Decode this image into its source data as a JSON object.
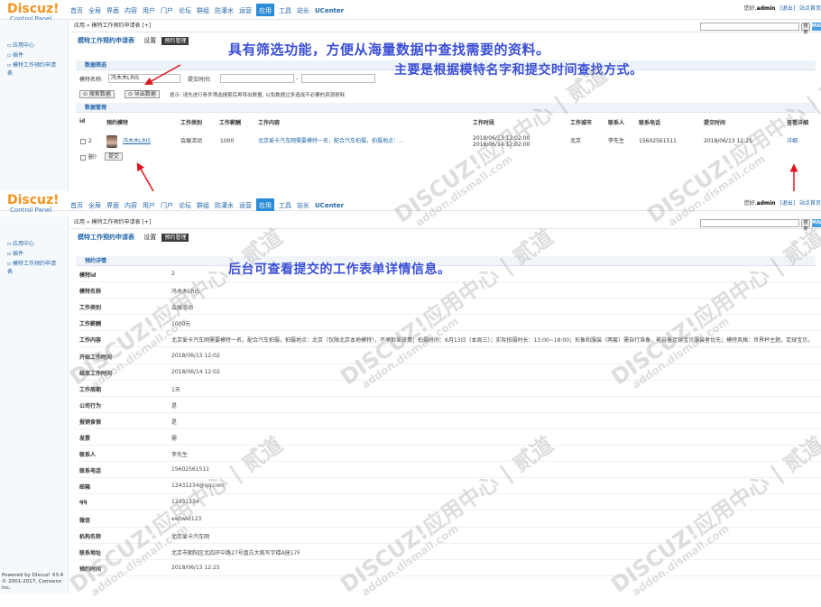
{
  "logo": {
    "name": "Discuz!",
    "sub": "Control Panel"
  },
  "nav": [
    "首页",
    "全局",
    "界面",
    "内容",
    "用户",
    "门户",
    "论坛",
    "群组",
    "防灌水",
    "运营",
    "应用",
    "工具",
    "站长",
    "UCenter"
  ],
  "nav_active_index": 10,
  "topbar": {
    "greeting": "您好,",
    "user": "admin",
    "logout": "[退出]",
    "home": "站点首页"
  },
  "search": {
    "button": "搜索",
    "map": "MAP"
  },
  "sidebar": {
    "items": [
      "应用中心",
      "插件",
      "模特工作预约申请表"
    ]
  },
  "powered": {
    "line1": "Powered by Discuz! X3.4",
    "line2": "© 2001-2017, Comsenz Inc."
  },
  "crumb": "应用 » 模特工作预约申请表 [+]",
  "tabs": {
    "title": "模特工作预约申请表",
    "settings": "设置",
    "manage": "预约管理"
  },
  "shot1": {
    "section_filter": "数据筛选",
    "filter": {
      "name_label": "模特名称:",
      "name_value": "冯木木LRIS",
      "time_label": "提交时间:",
      "dash": "-"
    },
    "buttons": {
      "search": "⊙ 搜索数据",
      "export": "⊙ 导出数据"
    },
    "tip": "提示: 请先进行条件筛选搜索后再导出数据, 以免数据过多造成不必要的资源损耗",
    "section_manage": "数据管理",
    "columns": [
      "id",
      "预约模特",
      "工作类别",
      "工作薪酬",
      "工作内容",
      "工作时段",
      "工作城市",
      "联系人",
      "联系电话",
      "提交时间",
      "查看详细"
    ],
    "row": {
      "id": "2",
      "model": "冯木木LRIS",
      "category": "会展活动",
      "pay": "1000",
      "content": "北京爱卡汽车网需要模特一名，配合汽车拍摄，拍摄地点：...",
      "period1": "2018/06/13 12:02:00",
      "period2": "2018/06/14 12:02:00",
      "city": "北京",
      "contact": "李先生",
      "phone": "15602561511",
      "submitted": "2018/06/13 12:25",
      "detail": "详细"
    },
    "delete_label": "删?",
    "submit": "提交",
    "callout1": "具有筛选功能，方便从海量数据中查找需要的资料。",
    "callout2": "主要是根据模特名字和提交时间查找方式。"
  },
  "shot2": {
    "section": "预约详情",
    "callout": "后台可查看提交的工作表单详情信息。",
    "fields": [
      {
        "k": "模特id",
        "v": "2"
      },
      {
        "k": "模特名称",
        "v": "冯木木LRIS"
      },
      {
        "k": "工作类别",
        "v": "会展活动"
      },
      {
        "k": "工作薪酬",
        "v": "1000元"
      },
      {
        "k": "工作内容",
        "v": "北京爱卡汽车网需要模特一名，配合汽车拍摄，拍摄地点：北京（仅限北京本地模特），不承担差旅费；拍摄时间：6月13日（本周三）；实际拍摄时长：13:00~18:00；形象和服装（两套）需自行准备，能自备足球宝贝服装者优先；模特风格：世界杯主题，足球宝贝。"
      },
      {
        "k": "开始工作时间",
        "v": "2018/06/13 12:02"
      },
      {
        "k": "结束工作时间",
        "v": "2018/06/14 12:02"
      },
      {
        "k": "工作周期",
        "v": "1天"
      },
      {
        "k": "公司行为",
        "v": "是"
      },
      {
        "k": "报销食宿",
        "v": "是"
      },
      {
        "k": "发票",
        "v": "需"
      },
      {
        "k": "联系人",
        "v": "李先生"
      },
      {
        "k": "联系电话",
        "v": "15602561511"
      },
      {
        "k": "邮箱",
        "v": "12431234@qq.com"
      },
      {
        "k": "qq",
        "v": "12431234"
      },
      {
        "k": "微信",
        "v": "ewtwet123"
      },
      {
        "k": "机构名称",
        "v": "北京爱卡汽车网"
      },
      {
        "k": "联系地址",
        "v": "北京市朝阳区北四环中路27号盘古大观写字楼A座17F"
      },
      {
        "k": "预约时间",
        "v": "2018/06/13 12:25"
      }
    ]
  },
  "watermark": {
    "line1": "DISCUZ!应用中心 | 贰道",
    "line2": "addon.dismall.com"
  },
  "colors": {
    "accent": "#2a8bd6",
    "logo": "#f7931e",
    "callout": "#3b4fd6",
    "arrow": "#e0141e"
  }
}
